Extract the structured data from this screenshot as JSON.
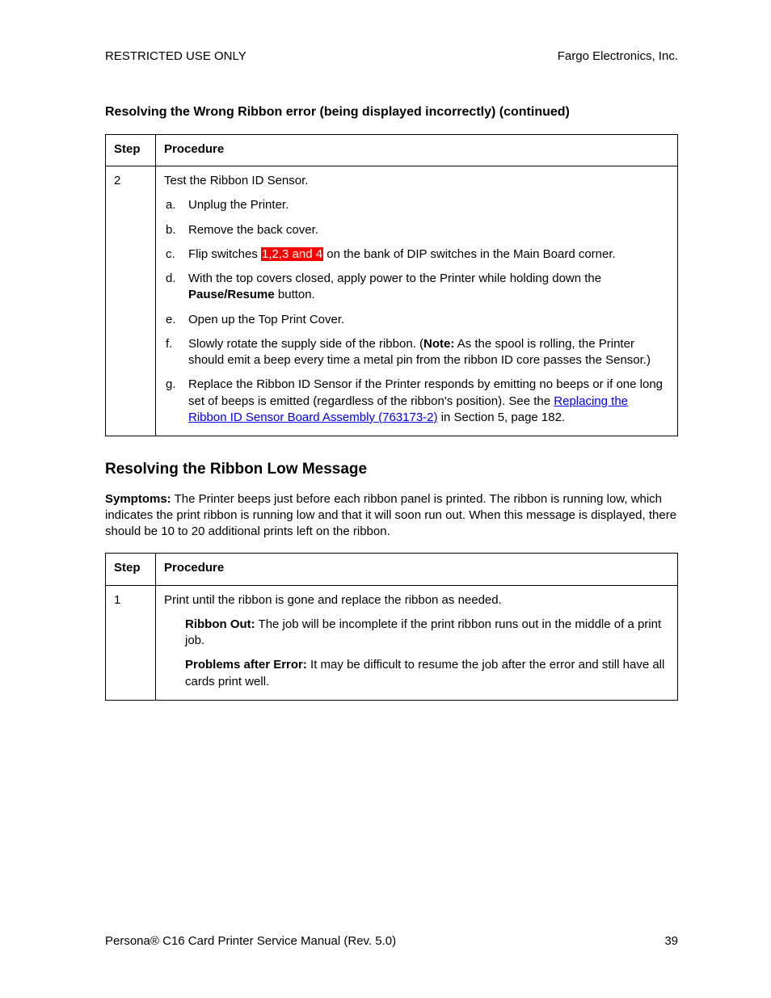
{
  "header": {
    "left": "RESTRICTED USE ONLY",
    "right": "Fargo Electronics, Inc."
  },
  "section1": {
    "title": "Resolving the Wrong Ribbon error (being displayed incorrectly) (continued)",
    "table": {
      "head": {
        "step": "Step",
        "proc": "Procedure"
      },
      "row": {
        "step": "2",
        "intro": "Test the Ribbon ID Sensor.",
        "items": {
          "a": {
            "label": "a.",
            "text": "Unplug the Printer."
          },
          "b": {
            "label": "b.",
            "text": "Remove the back cover."
          },
          "c": {
            "label": "c.",
            "pre": "Flip switches ",
            "hl": "1,2,3 and 4",
            "post": " on the bank of DIP switches in the Main Board corner."
          },
          "d": {
            "label": "d.",
            "pre": "With the top covers closed, apply power to the Printer while holding down the ",
            "bold": "Pause/Resume",
            "post": " button."
          },
          "e": {
            "label": "e.",
            "text": "Open up the Top Print Cover."
          },
          "f": {
            "label": "f.",
            "pre": "Slowly rotate the supply side of the ribbon. (",
            "bold": "Note:",
            "post": "  As the spool is rolling, the Printer should emit a beep every time a metal pin from the ribbon ID core passes the Sensor.)"
          },
          "g": {
            "label": "g.",
            "pre": "Replace the Ribbon ID Sensor if the Printer responds by emitting no beeps or if one long set of beeps is emitted (regardless of the ribbon's position). See the ",
            "link": "Replacing the Ribbon ID Sensor Board Assembly (763173-2)",
            "post": " in Section 5, page 182."
          }
        }
      }
    }
  },
  "section2": {
    "title": "Resolving the Ribbon Low Message",
    "symptoms": {
      "label": "Symptoms:",
      "text": "  The Printer beeps just before each ribbon panel is printed. The ribbon is running low, which indicates the print ribbon is running low and that it will soon run out. When this message is displayed, there should be 10 to 20 additional prints left on the ribbon."
    },
    "table": {
      "head": {
        "step": "Step",
        "proc": "Procedure"
      },
      "row": {
        "step": "1",
        "intro": "Print until the ribbon is gone and replace the ribbon as needed.",
        "n1": {
          "bold": "Ribbon Out:",
          "text": "  The job will be incomplete if the print ribbon runs out in the middle of a print job."
        },
        "n2": {
          "bold": "Problems after Error:",
          "text": "  It may be difficult to resume the job after the error and still have all cards print well."
        }
      }
    }
  },
  "footer": {
    "left_pre": "Persona",
    "reg": "®",
    "left_post": " C16 Card Printer Service Manual (Rev. 5.0)",
    "page": "39"
  }
}
